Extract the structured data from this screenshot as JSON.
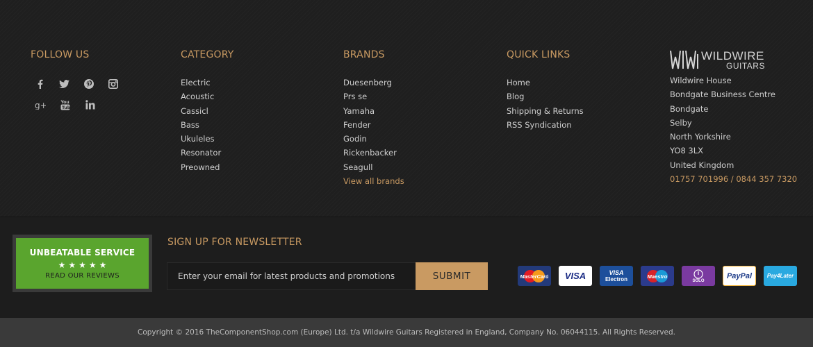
{
  "follow_us": {
    "heading": "FOLLOW US",
    "icons": [
      "facebook-icon",
      "twitter-icon",
      "pinterest-icon",
      "instagram-icon",
      "google-plus-icon",
      "youtube-icon",
      "linkedin-icon"
    ]
  },
  "category": {
    "heading": "CATEGORY",
    "items": [
      "Electric",
      "Acoustic",
      "Cassicl",
      "Bass",
      "Ukuleles",
      "Resonator",
      "Preowned"
    ]
  },
  "brands": {
    "heading": "BRANDS",
    "items": [
      "Duesenberg",
      "Prs se",
      "Yamaha",
      "Fender",
      "Godin",
      "Rickenbacker",
      "Seagull"
    ],
    "view_all": "View all brands"
  },
  "quick_links": {
    "heading": "QUICK LINKS",
    "items": [
      "Home",
      "Blog",
      "Shipping & Returns",
      "RSS Syndication"
    ]
  },
  "company": {
    "logo_main": "WILDWIRE",
    "logo_sub": "GUITARS",
    "address": [
      "Wildwire House",
      "Bondgate Business Centre",
      "Bondgate",
      "Selby",
      "North Yorkshire",
      "YO8 3LX",
      "United Kingdom"
    ],
    "phone": "01757 701996 / 0844 357 7320"
  },
  "service_badge": {
    "title": "UNBEATABLE SERVICE",
    "stars": "★★★★★",
    "link": "READ OUR REVIEWS",
    "bg_color": "#5aa52e"
  },
  "newsletter": {
    "heading": "SIGN UP FOR NEWSLETTER",
    "placeholder": "Enter your email for latest products and promotions",
    "button": "SUBMIT"
  },
  "payment_cards": {
    "mastercard": "MasterCard",
    "visa": "VISA",
    "visa_electron_top": "VISA",
    "visa_electron_bottom": "Electron",
    "maestro": "Maestro",
    "solo": "SOLO",
    "paypal": "PayPal",
    "pay4later": "Pay4Later"
  },
  "copyright": "Copyright © 2016 TheComponentShop.com (Europe) Ltd. t/a Wildwire Guitars Registered in England, Company No. 06044115. All Rights Reserved.",
  "colors": {
    "accent": "#c99a62",
    "background": "#1d1d1d",
    "copyright_bar": "#3a3a3a"
  }
}
